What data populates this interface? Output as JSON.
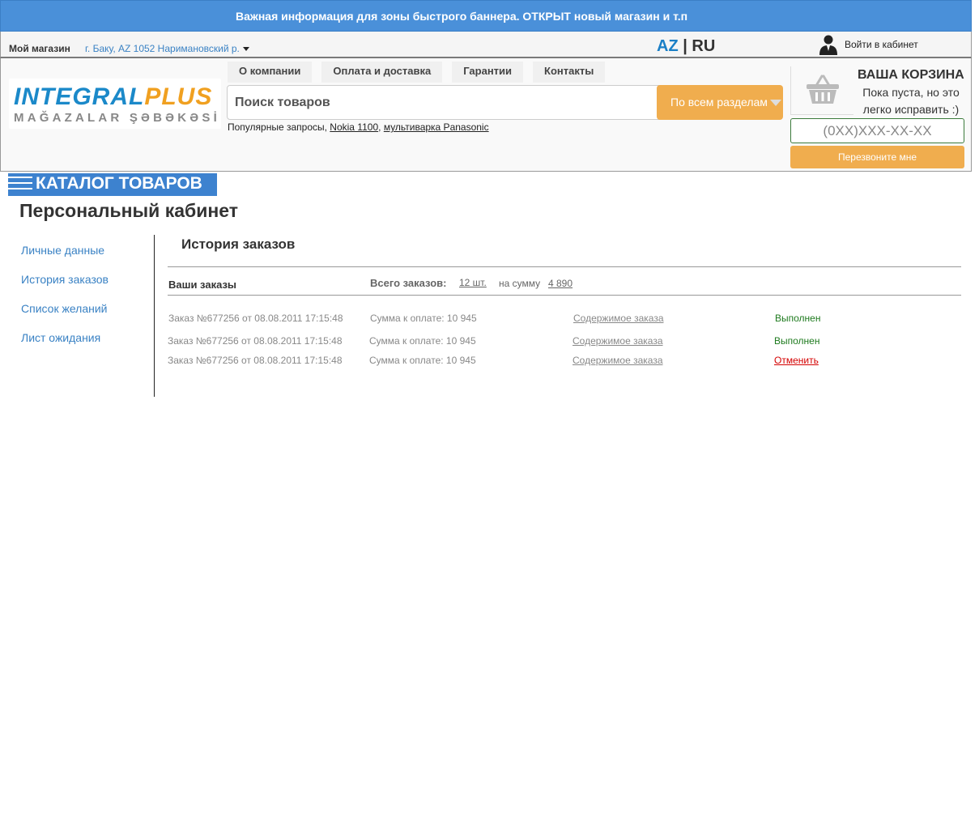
{
  "banner": {
    "text": "Важная информация для зоны быстрого баннера. ОТКРЫТ новый магазин и т.п"
  },
  "topbar": {
    "my_store_label": "Мой магазин",
    "city": "г. Баку, AZ 1052 Наримановский р.",
    "lang_az": "AZ",
    "lang_sep": "|",
    "lang_ru": "RU",
    "login_label": "Войти в кабинет"
  },
  "logo": {
    "part1": "INTEGRAL",
    "part2": "PLUS",
    "tagline": "MAĞAZALAR ŞƏBƏKƏSİ"
  },
  "nav": [
    {
      "label": "О компании"
    },
    {
      "label": "Оплата и доставка"
    },
    {
      "label": "Гарантии"
    },
    {
      "label": "Контакты"
    }
  ],
  "search": {
    "placeholder": "Поиск товаров",
    "scope_label": "По всем разделам",
    "popular_label": "Популярные запросы,",
    "popular_1": "Nokia 1100",
    "popular_sep": ",",
    "popular_2": "мультиварка Panasonic"
  },
  "cart": {
    "title": "ВАША КОРЗИНА",
    "subtitle": "Пока пуста, но это легко исправить :)"
  },
  "callback": {
    "phone_placeholder": "(0XX)XXX-XX-XX",
    "button_label": "Перезвоните мне"
  },
  "catalog": {
    "label": "КАТАЛОГ ТОВАРОВ"
  },
  "page": {
    "title": "Персональный кабинет"
  },
  "sidebar": {
    "items": [
      {
        "label": "Личные данные"
      },
      {
        "label": "История заказов"
      },
      {
        "label": "Список желаний"
      },
      {
        "label": "Лист ожидания"
      }
    ]
  },
  "orders": {
    "section_title": "История заказов",
    "your_orders": "Ваши заказы",
    "total_label": "Всего заказов:",
    "total_count": "12 шт.",
    "sum_label": "на сумму",
    "sum_value": "4 890",
    "rows": [
      {
        "order": "Заказ №677256 от 08.08.2011 17:15:48",
        "amount": "Сумма к оплате: 10 945",
        "contents": "Содержимое заказа",
        "status": "Выполнен"
      },
      {
        "order": "Заказ №677256 от 08.08.2011 17:15:48",
        "amount": "Сумма к оплате: 10 945",
        "contents": "Содержимое заказа",
        "status": "Выполнен"
      },
      {
        "order": "Заказ №677256 от 08.08.2011 17:15:48",
        "amount": "Сумма к оплате: 10 945",
        "contents": "Содержимое заказа",
        "status": "Отменить"
      }
    ]
  },
  "colors": {
    "banner": "#4a90d9",
    "accent_orange": "#f0ad4e",
    "link_blue": "#3a82c4",
    "status_done": "#1e7a1e",
    "status_cancel": "#d40000"
  }
}
